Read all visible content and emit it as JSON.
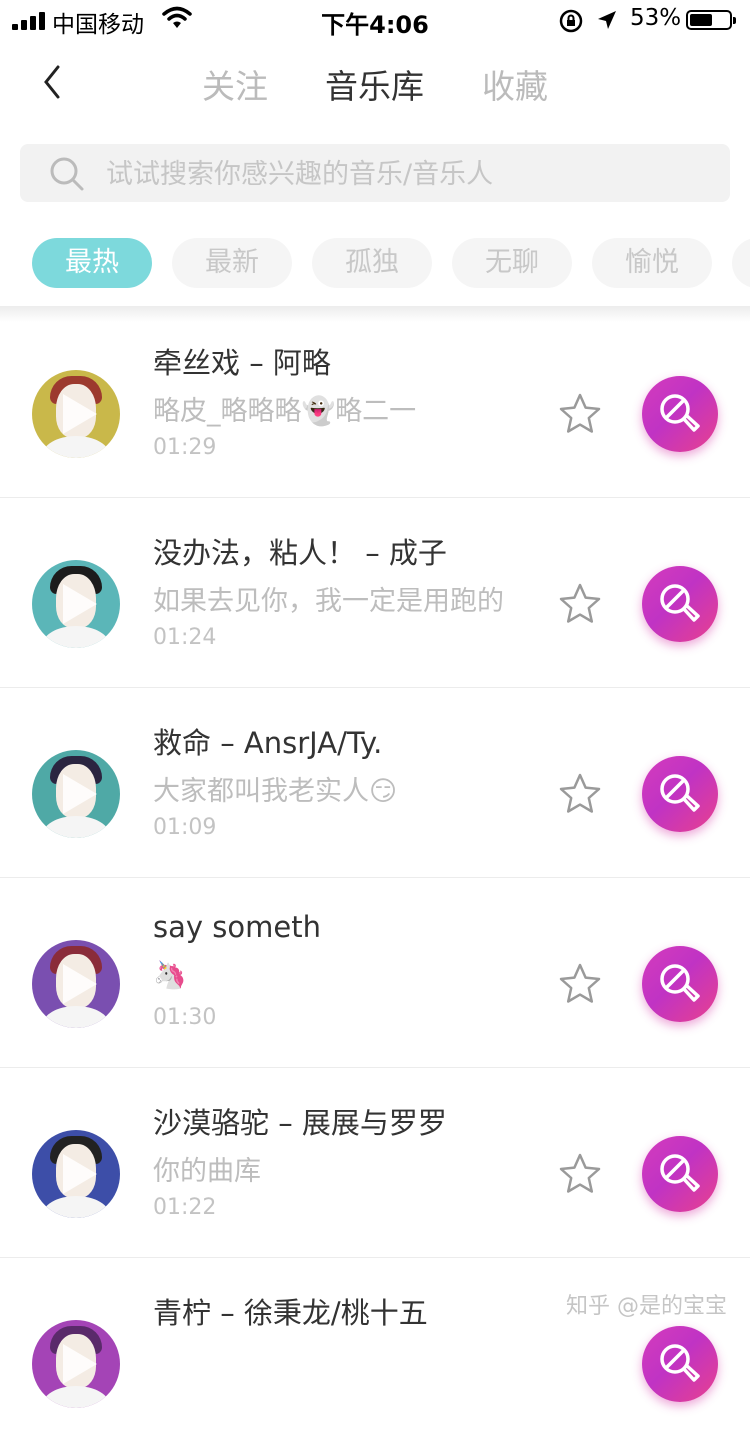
{
  "status_bar": {
    "carrier": "中国移动",
    "time": "下午4:06",
    "battery": "53%"
  },
  "nav": {
    "tabs": [
      {
        "label": "关注"
      },
      {
        "label": "音乐库"
      },
      {
        "label": "收藏"
      }
    ],
    "active_tab": "音乐库"
  },
  "search": {
    "placeholder": "试试搜索你感兴趣的音乐/音乐人"
  },
  "filters": [
    {
      "label": "最热"
    },
    {
      "label": "最新"
    },
    {
      "label": "孤独"
    },
    {
      "label": "无聊"
    },
    {
      "label": "愉悦"
    }
  ],
  "songs": [
    {
      "title": "牵丝戏 – 阿略",
      "desc": "略皮_略略略👻略二一",
      "duration": "01:29"
    },
    {
      "title": "没办法，粘人！ – 成子",
      "desc": "如果去见你，我一定是用跑的",
      "duration": "01:24"
    },
    {
      "title": "救命 – AnsrJA/Ty.",
      "desc": "大家都叫我老实人😏",
      "duration": "01:09"
    },
    {
      "title": "say someth",
      "desc": "🦄",
      "duration": "01:30"
    },
    {
      "title": "沙漠骆驼 – 展展与罗罗",
      "desc": "你的曲库",
      "duration": "01:22"
    },
    {
      "title": "青柠 – 徐秉龙/桃十五",
      "desc": "",
      "duration": ""
    }
  ],
  "colors": {
    "accent_chip": "#7dd9dc",
    "sing_button": "#c93bc0"
  },
  "watermark": "知乎 @是的宝宝"
}
